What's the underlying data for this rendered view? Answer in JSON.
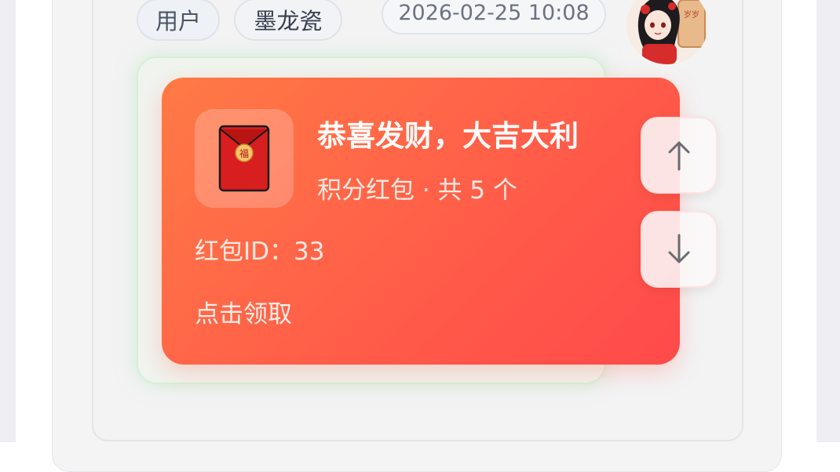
{
  "message": {
    "role_tag": "用户",
    "username": "墨龙瓷",
    "timestamp": "2026-02-25 10:08",
    "avatar_icon": "anime-avatar-icon"
  },
  "red_packet": {
    "title": "恭喜发财，大吉大利",
    "subtitle": "积分红包 · 共 5 个",
    "id_line": "红包ID：33",
    "claim_label": "点击领取",
    "icon": "red-envelope-icon",
    "colors": {
      "gradient_start": "#ff7a45",
      "gradient_end": "#ff4a4a",
      "envelope": "#d81e1e"
    }
  },
  "controls": {
    "scroll_up_icon": "arrow-up-icon",
    "scroll_down_icon": "arrow-down-icon"
  }
}
